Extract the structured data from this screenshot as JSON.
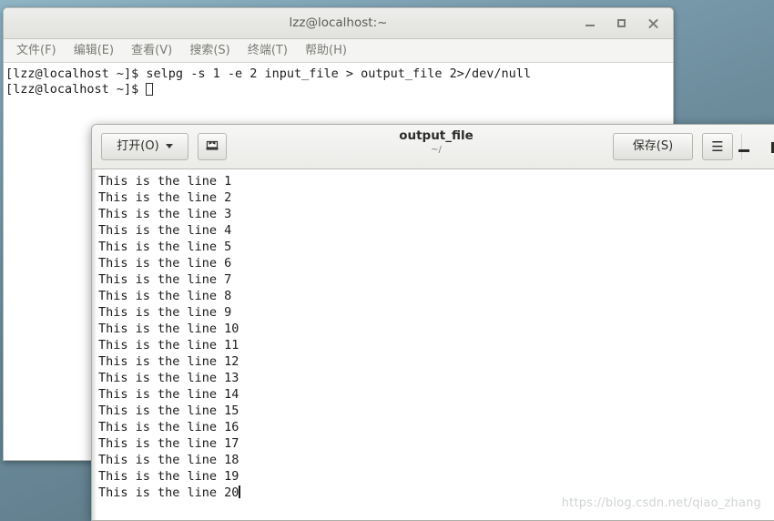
{
  "terminal": {
    "title": "lzz@localhost:~",
    "window_controls": [
      {
        "name": "minimize",
        "glyph": "minimize-icon"
      },
      {
        "name": "maximize",
        "glyph": "maximize-icon"
      },
      {
        "name": "close",
        "glyph": "close-icon"
      }
    ],
    "menu": [
      {
        "label": "文件(F)"
      },
      {
        "label": "编辑(E)"
      },
      {
        "label": "查看(V)"
      },
      {
        "label": "搜索(S)"
      },
      {
        "label": "终端(T)"
      },
      {
        "label": "帮助(H)"
      }
    ],
    "lines": [
      "[lzz@localhost ~]$ selpg -s 1 -e 2 input_file > output_file 2>/dev/null",
      "[lzz@localhost ~]$ "
    ],
    "prompt": "[lzz@localhost ~]$ ",
    "command": "selpg -s 1 -e 2 input_file > output_file 2>/dev/null"
  },
  "gedit": {
    "title": "output_file",
    "subtitle": "~/",
    "open_button": "打开(O)",
    "save_button": "保存(S)",
    "menu_button": "☰",
    "saveas_icon": "save-as-icon",
    "window_controls": [
      {
        "name": "minimize",
        "glyph": "minimize-icon"
      },
      {
        "name": "maximize",
        "glyph": "maximize-icon"
      }
    ],
    "document_lines": [
      "This is the line 1",
      "This is the line 2",
      "This is the line 3",
      "This is the line 4",
      "This is the line 5",
      "This is the line 6",
      "This is the line 7",
      "This is the line 8",
      "This is the line 9",
      "This is the line 10",
      "This is the line 11",
      "This is the line 12",
      "This is the line 13",
      "This is the line 14",
      "This is the line 15",
      "This is the line 16",
      "This is the line 17",
      "This is the line 18",
      "This is the line 19",
      "This is the line 20"
    ]
  },
  "watermark": "https://blog.csdn.net/qiao_zhang",
  "colors": {
    "desktop_top": "#8fb4c4",
    "desktop_bottom": "#5d7886",
    "titlebar": "#e7e7e4",
    "terminal_text": "#1d1d1d",
    "document_text": "#1b1b1b",
    "menu_text": "#7a7a76"
  }
}
